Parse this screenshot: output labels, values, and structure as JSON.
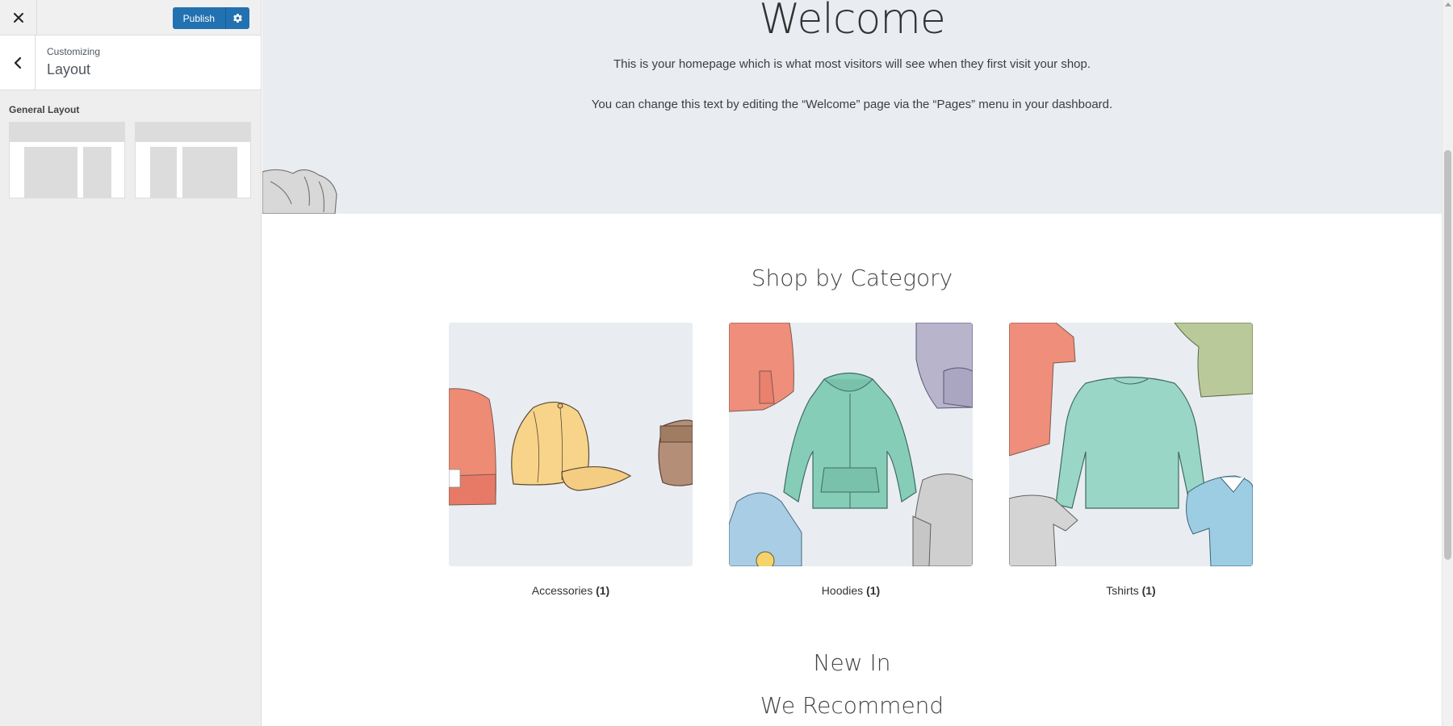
{
  "customizer": {
    "publish_label": "Publish",
    "breadcrumb": "Customizing",
    "panel_title": "Layout",
    "section_label": "General Layout",
    "layout_options": [
      "right-sidebar",
      "left-sidebar"
    ],
    "accent_color": "#2271b1"
  },
  "icons": {
    "close": "close-icon",
    "settings": "gear-icon",
    "back": "chevron-left-icon"
  },
  "hero": {
    "title": "Welcome",
    "text1": "This is your homepage which is what most visitors will see when they first visit your shop.",
    "text2": "You can change this text by editing the “Welcome” page via the “Pages” menu in your dashboard."
  },
  "shop_by_category": {
    "title": "Shop by Category",
    "categories": [
      {
        "name": "Accessories",
        "count": "(1)"
      },
      {
        "name": "Hoodies",
        "count": "(1)"
      },
      {
        "name": "Tshirts",
        "count": "(1)"
      }
    ]
  },
  "new_in": {
    "title": "New In"
  },
  "we_recommend": {
    "title": "We Recommend"
  }
}
